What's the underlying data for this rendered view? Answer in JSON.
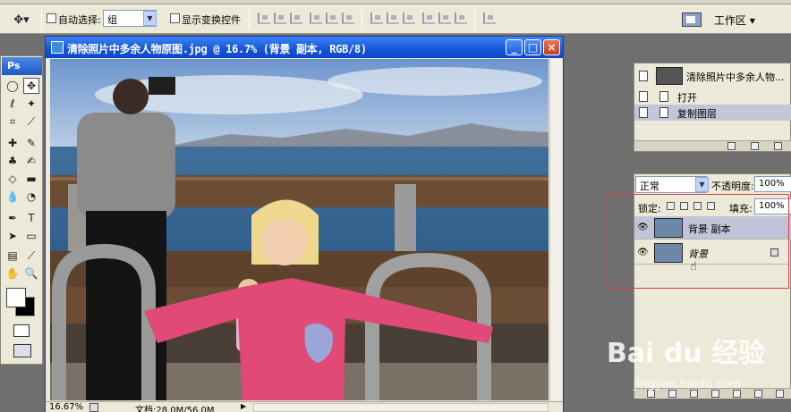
{
  "options_bar": {
    "auto_select_label": "自动选择:",
    "auto_select_value": "组",
    "show_transform_label": "显示变换控件",
    "workspace_label": "工作区 ▾"
  },
  "toolbox": {
    "logo": "Ps"
  },
  "document": {
    "title": "清除照片中多余人物原图.jpg @ 16.7% (背景 副本, RGB/8)",
    "zoom": "16.67%",
    "doc_size": "文档:28.0M/56.0M"
  },
  "history": {
    "snapshot_label": "清除照片中多余人物...",
    "items": [
      "打开",
      "复制图层"
    ]
  },
  "layers": {
    "blend_mode": "正常",
    "opacity_label": "不透明度:",
    "opacity_value": "100%",
    "lock_label": "锁定:",
    "fill_label": "填充:",
    "fill_value": "100%",
    "items": [
      {
        "name": "背景 副本",
        "selected": true
      },
      {
        "name": "背景",
        "selected": false,
        "locked": true
      }
    ]
  },
  "watermark": {
    "brand": "Bai du 经验",
    "url": "jingyan.baidu.com"
  }
}
